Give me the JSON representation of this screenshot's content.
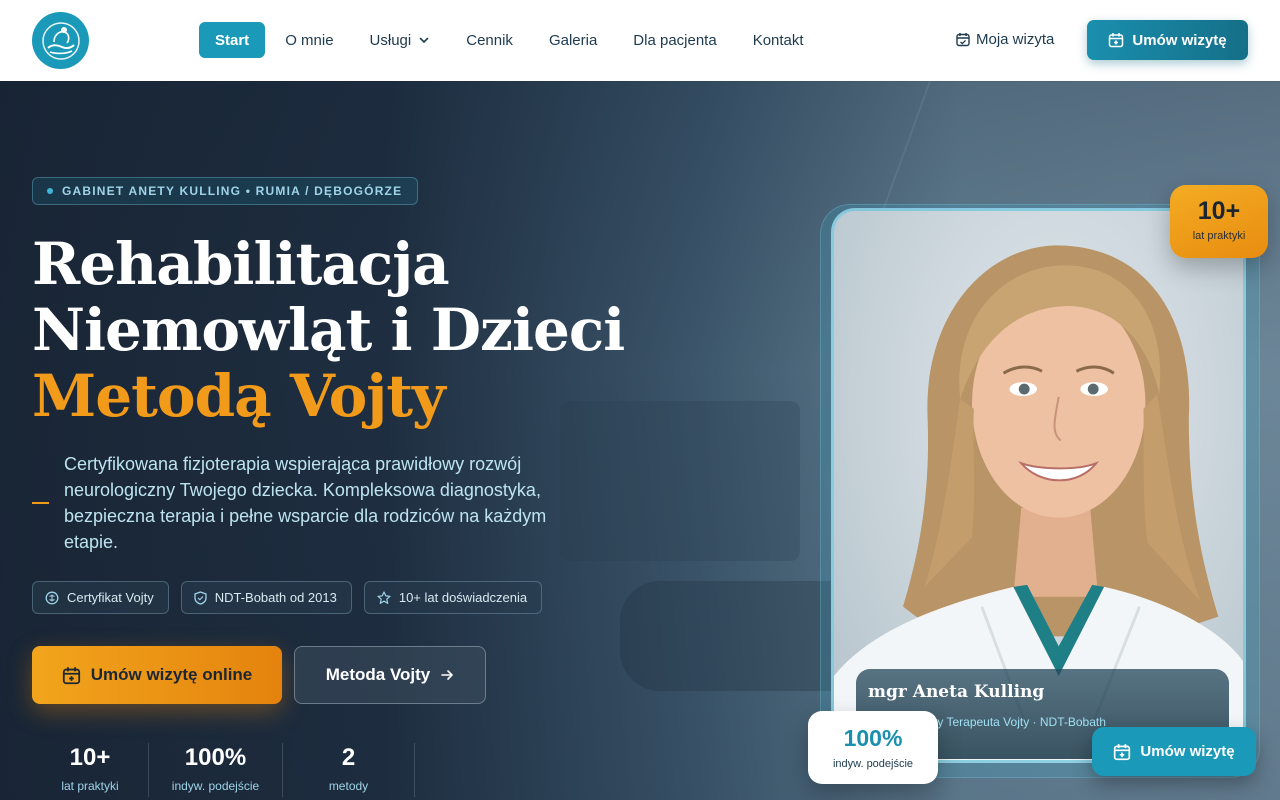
{
  "header": {
    "logo_icon": "mother-child-hands-logo",
    "nav": [
      {
        "label": "Start",
        "active": true
      },
      {
        "label": "O mnie"
      },
      {
        "label": "Usługi",
        "has_dropdown": true
      },
      {
        "label": "Cennik"
      },
      {
        "label": "Galeria"
      },
      {
        "label": "Dla pacjenta"
      },
      {
        "label": "Kontakt"
      }
    ],
    "my_visit_label": "Moja wizyta",
    "book_label": "Umów wizytę"
  },
  "hero": {
    "badge": "GABINET ANETY KULLING • RUMIA / DĘBOGÓRZE",
    "title_line1": "Rehabilitacja",
    "title_line2": "Niemowląt i Dzieci",
    "title_accent": "Metodą Vojty",
    "lead": "Certyfikowana fizjoterapia wspierająca prawidłowy rozwój neurologiczny Twojego dziecka. Kompleksowa diagnostyka, bezpieczna terapia i pełne wsparcie dla rodziców na każdym etapie.",
    "chips": [
      {
        "icon": "certificate-icon",
        "label": "Certyfikat Vojty"
      },
      {
        "icon": "shield-icon",
        "label": "NDT-Bobath od 2013"
      },
      {
        "icon": "star-icon",
        "label": "10+ lat doświadczenia"
      }
    ],
    "primary_button": "Umów wizytę online",
    "secondary_button": "Metoda Vojty",
    "stats": [
      {
        "value": "10+",
        "label": "lat praktyki"
      },
      {
        "value": "100%",
        "label": "indyw. podejście"
      },
      {
        "value": "2",
        "label": "metody"
      }
    ]
  },
  "card": {
    "name": "mgr Aneta Kulling",
    "role": "Certyfikowany Terapeuta Vojty · NDT-Bobath",
    "experience_value": "10+",
    "experience_label": "lat praktyki",
    "approach_value": "100%",
    "approach_label": "indyw. podejście",
    "floating_cta": "Umów wizytę"
  },
  "colors": {
    "brand": "#1a9ab8",
    "accent": "#f29a19",
    "dark": "#1c2b3c"
  }
}
